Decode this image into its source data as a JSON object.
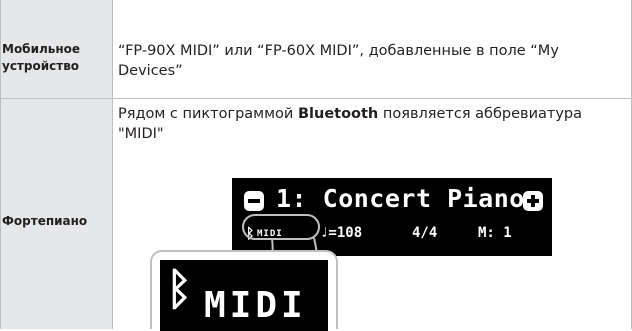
{
  "rows": [
    {
      "label": "Мобильное устройство",
      "text": "“FP-90X MIDI” или “FP-60X MIDI”, добавленные в поле “My Devices”"
    },
    {
      "label": "Фортепиано",
      "text_before": "Рядом с пиктограммой ",
      "text_bold": "Bluetooth",
      "text_after": " появляется аббревиатура \"MIDI\""
    }
  ],
  "lcd": {
    "title": "1: Concert Piano",
    "bt_icon": "bluetooth-icon",
    "midi_small": "MIDI",
    "tempo": "♩=108",
    "time_signature": "4/4",
    "measure": "M: 1"
  },
  "zoom": {
    "bt_icon": "bluetooth-icon",
    "midi": "MIDI"
  }
}
